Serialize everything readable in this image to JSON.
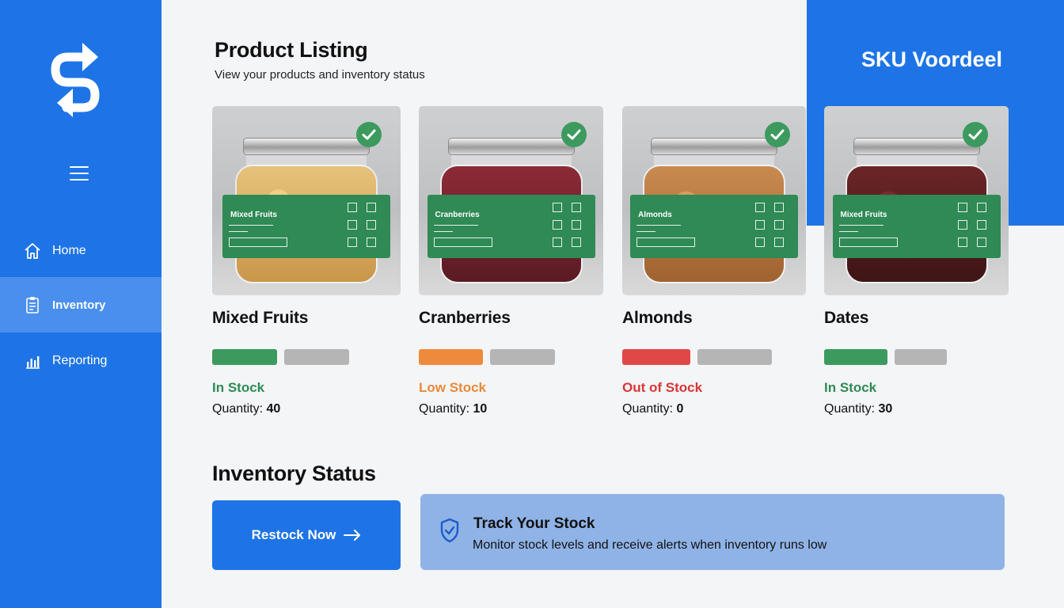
{
  "sidebar": {
    "nav": [
      {
        "label": "Home",
        "icon": "home-icon"
      },
      {
        "label": "Inventory",
        "icon": "clipboard-icon",
        "active": true
      },
      {
        "label": "Reporting",
        "icon": "bar-chart-icon"
      }
    ]
  },
  "header": {
    "title": "Product Listing",
    "subtitle": "View your products and inventory status"
  },
  "brand": {
    "name": "SKU Voordeel"
  },
  "products": [
    {
      "name": "Mixed Fruits",
      "jar_label": "Mixed Fruits",
      "status": "In Stock",
      "status_color": "#2f8a55",
      "quantity_label": "Quantity:",
      "quantity": "40",
      "stock_level": 0.5
    },
    {
      "name": "Cranberries",
      "jar_label": "Cranberries",
      "status": "Low Stock",
      "status_color": "#ea8a3a",
      "quantity_label": "Quantity:",
      "quantity": "10",
      "stock_level": 0.5
    },
    {
      "name": "Almonds",
      "jar_label": "Almonds",
      "status": "Out of Stock",
      "status_color": "#d93636",
      "quantity_label": "Quantity:",
      "quantity": "0",
      "stock_level": 0.5
    },
    {
      "name": "Dates",
      "jar_label": "Mixed Fruits",
      "status": "In Stock",
      "status_color": "#2f8a55",
      "quantity_label": "Quantity:",
      "quantity": "30",
      "stock_level": 0.5
    }
  ],
  "inventory_status": {
    "title": "Inventory Status",
    "restock_label": "Restock Now",
    "track_title": "Track Your Stock",
    "track_text": "Monitor stock levels and receive alerts when inventory runs low"
  },
  "colors": {
    "brand_blue": "#1e74e6",
    "green": "#2f8a55",
    "orange": "#ea8a3a",
    "red": "#d93636"
  }
}
